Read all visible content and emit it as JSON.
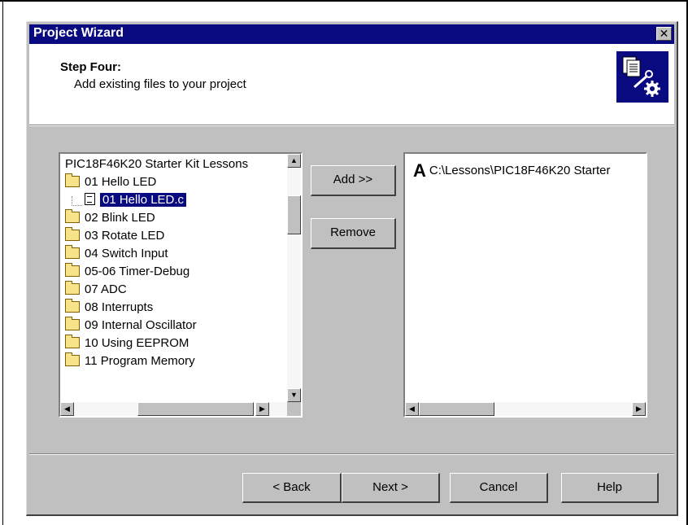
{
  "dialog": {
    "title": "Project Wizard",
    "close_glyph": "✕"
  },
  "header": {
    "step_title": "Step Four:",
    "step_description": "Add existing files to your project",
    "icon": "document-wrench-gear-icon"
  },
  "tree": {
    "root_label": "PIC18F46K20 Starter Kit Lessons",
    "items": [
      {
        "label": "01 Hello LED",
        "type": "folder"
      },
      {
        "label": "01 Hello LED.c",
        "type": "file",
        "selected": true
      },
      {
        "label": "02 Blink LED",
        "type": "folder"
      },
      {
        "label": "03 Rotate LED",
        "type": "folder"
      },
      {
        "label": "04 Switch Input",
        "type": "folder"
      },
      {
        "label": "05-06 Timer-Debug",
        "type": "folder"
      },
      {
        "label": "07 ADC",
        "type": "folder"
      },
      {
        "label": "08 Interrupts",
        "type": "folder"
      },
      {
        "label": "09 Internal Oscillator",
        "type": "folder"
      },
      {
        "label": "10 Using EEPROM",
        "type": "folder"
      },
      {
        "label": "11 Program Memory",
        "type": "folder"
      }
    ]
  },
  "actions": {
    "add_label": "Add >>",
    "remove_label": "Remove"
  },
  "files": {
    "items": [
      {
        "marker": "A",
        "path": "C:\\Lessons\\PIC18F46K20 Starter"
      }
    ]
  },
  "footer": {
    "back_label": "< Back",
    "next_label": "Next >",
    "cancel_label": "Cancel",
    "help_label": "Help"
  },
  "colors": {
    "titlebar": "#0a0a80",
    "dialog_face": "#c0c0c0",
    "selection": "#0a0a80"
  }
}
